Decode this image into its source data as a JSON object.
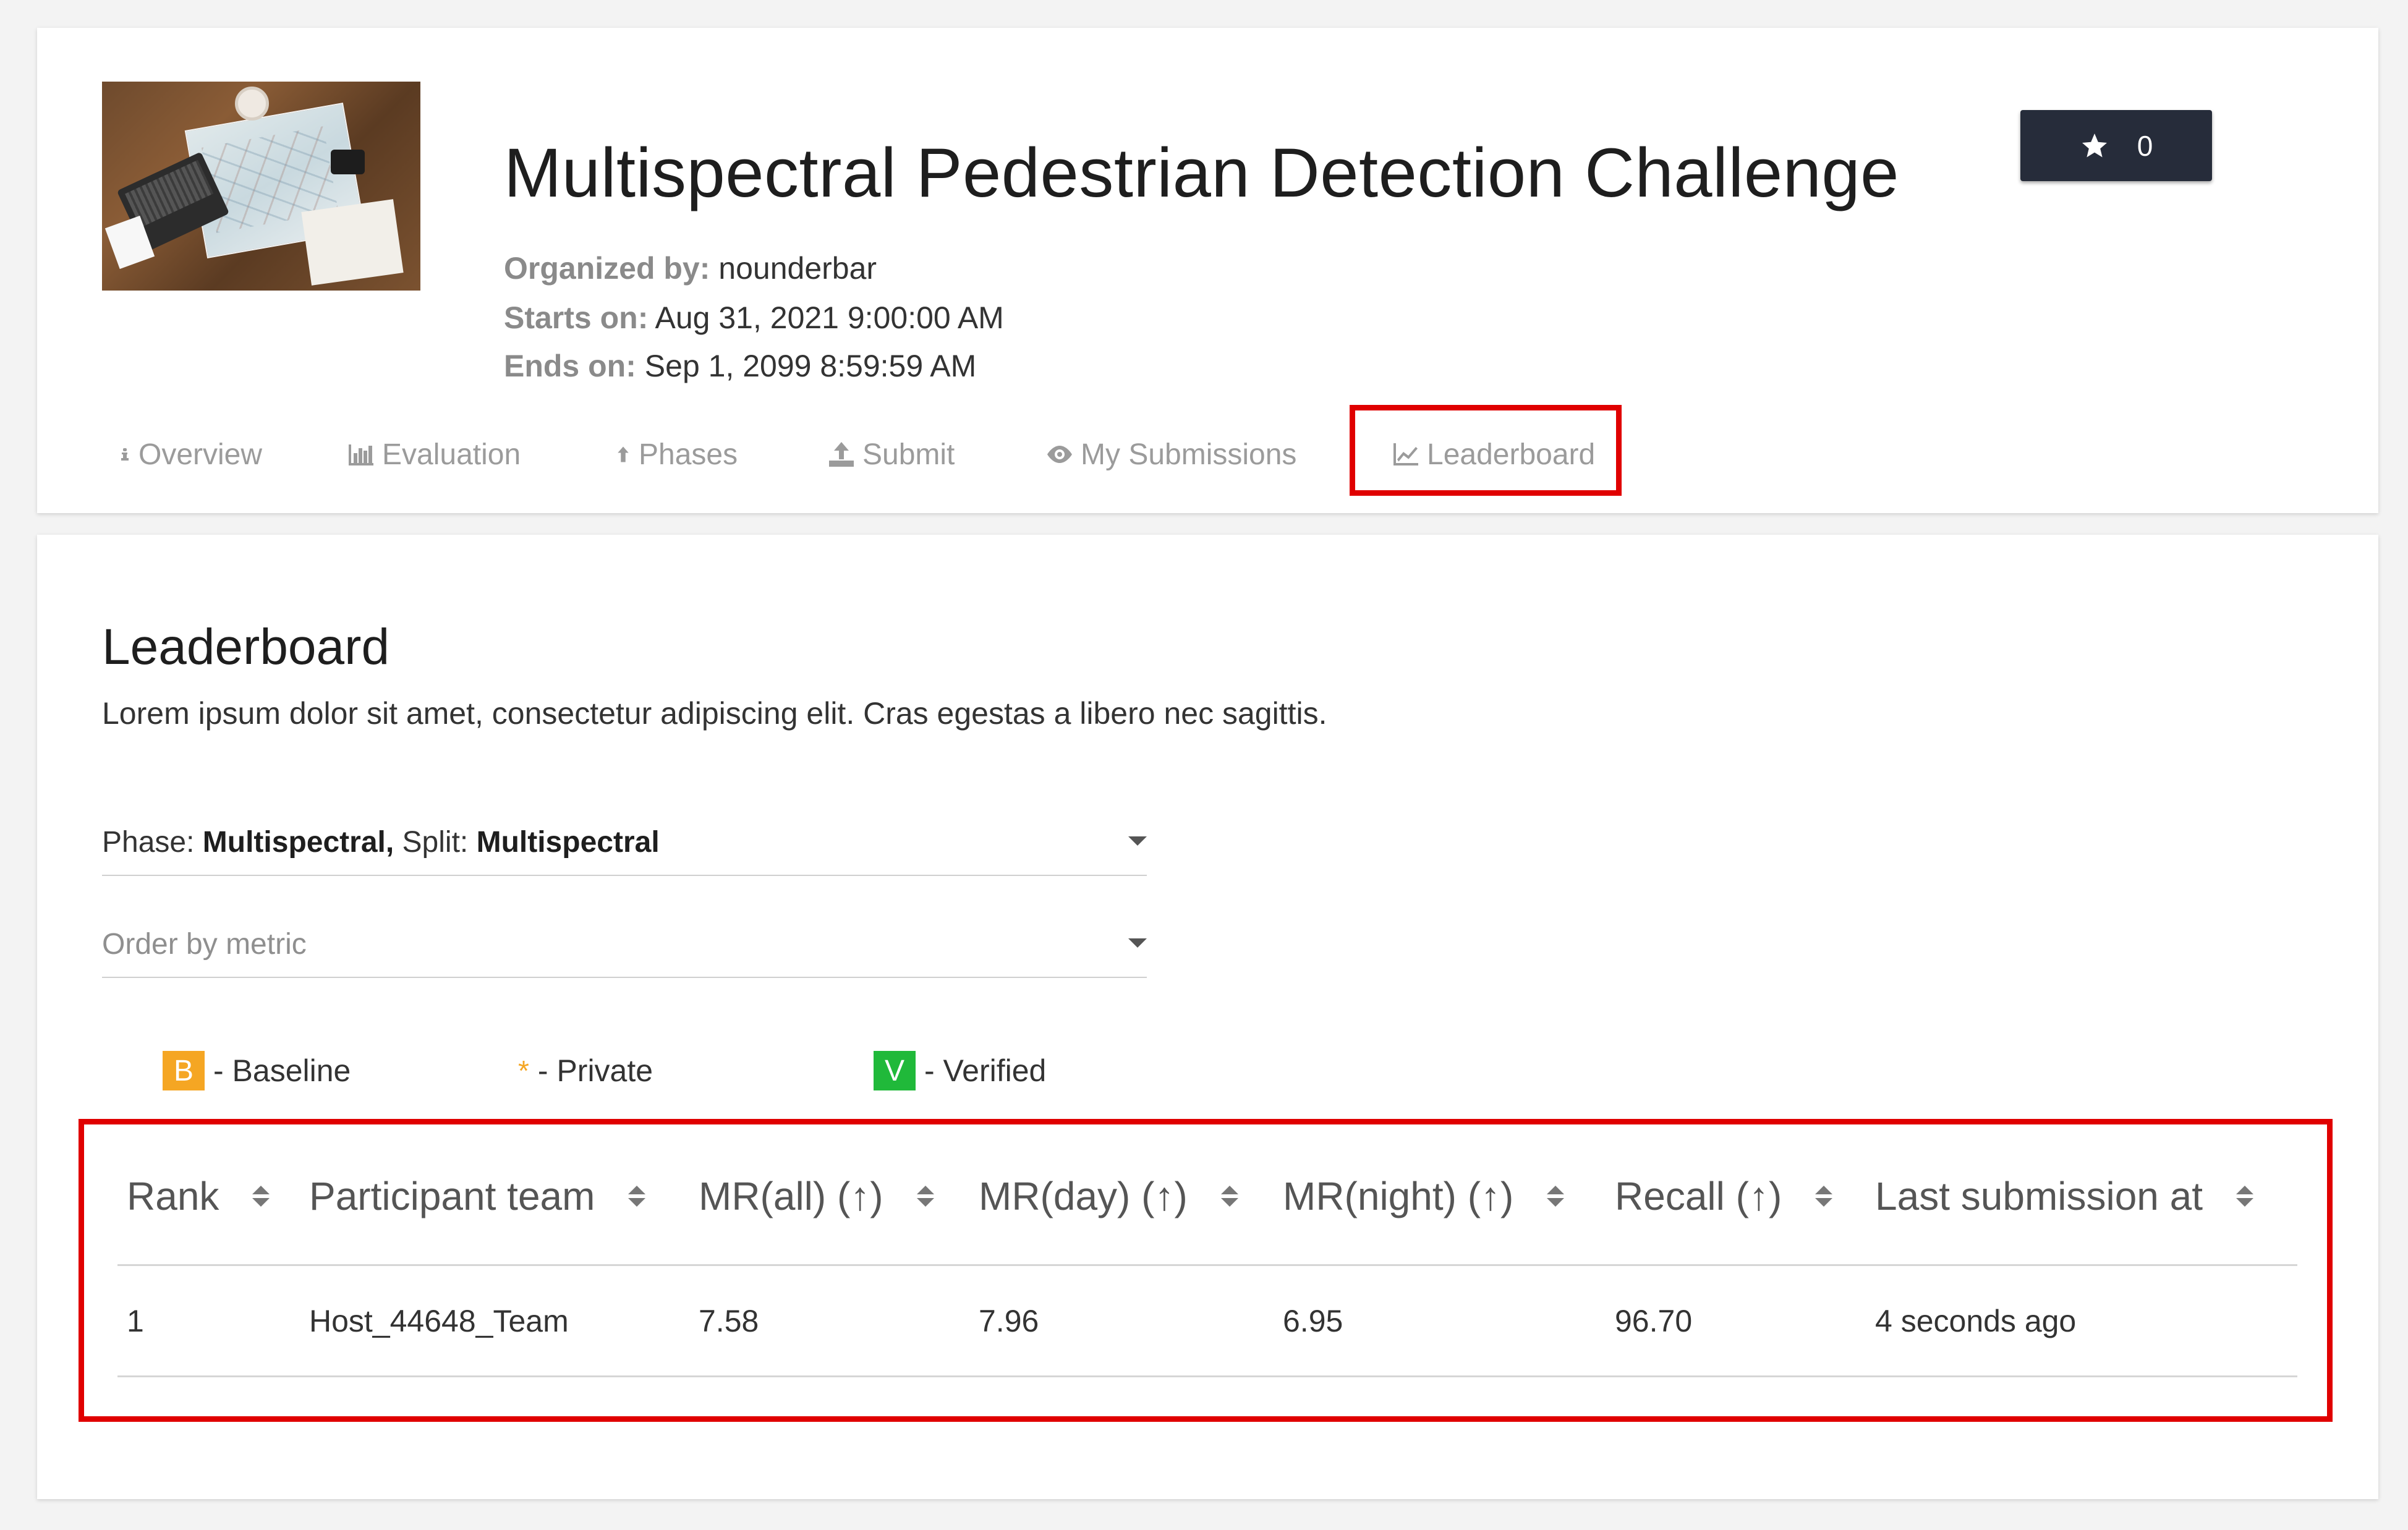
{
  "header": {
    "title": "Multispectral Pedestrian Detection Challenge",
    "organized_label": "Organized by:",
    "organized_value": "nounderbar",
    "starts_label": "Starts on:",
    "starts_value": "Aug 31, 2021 9:00:00 AM",
    "ends_label": "Ends on:",
    "ends_value": "Sep 1, 2099 8:59:59 AM",
    "star_count": "0"
  },
  "tabs": [
    {
      "label": "Overview",
      "icon": "info-icon"
    },
    {
      "label": "Evaluation",
      "icon": "bar-chart-icon"
    },
    {
      "label": "Phases",
      "icon": "arrow-up-icon"
    },
    {
      "label": "Submit",
      "icon": "upload-icon"
    },
    {
      "label": "My Submissions",
      "icon": "eye-icon"
    },
    {
      "label": "Leaderboard",
      "icon": "line-chart-icon"
    }
  ],
  "leaderboard": {
    "title": "Leaderboard",
    "description": "Lorem ipsum dolor sit amet, consectetur adipiscing elit. Cras egestas a libero nec sagittis.",
    "phase_label": "Phase:",
    "phase_value": "Multispectral,",
    "split_label": "Split:",
    "split_value": "Multispectral",
    "order_placeholder": "Order by metric",
    "legend": {
      "baseline_badge": "B",
      "baseline_label": "- Baseline",
      "private_mark": "*",
      "private_label": "- Private",
      "verified_badge": "V",
      "verified_label": "- Verified"
    },
    "columns": [
      "Rank",
      "Participant team",
      "MR(all) (↑)",
      "MR(day) (↑)",
      "MR(night) (↑)",
      "Recall (↑)",
      "Last submission at"
    ],
    "rows": [
      [
        "1",
        "Host_44648_Team",
        "7.58",
        "7.96",
        "6.95",
        "96.70",
        "4 seconds ago"
      ]
    ]
  },
  "colors": {
    "highlight": "#e00000",
    "star_button_bg": "#262c3a",
    "baseline_badge": "#f5a623",
    "verified_badge": "#20b93a"
  }
}
